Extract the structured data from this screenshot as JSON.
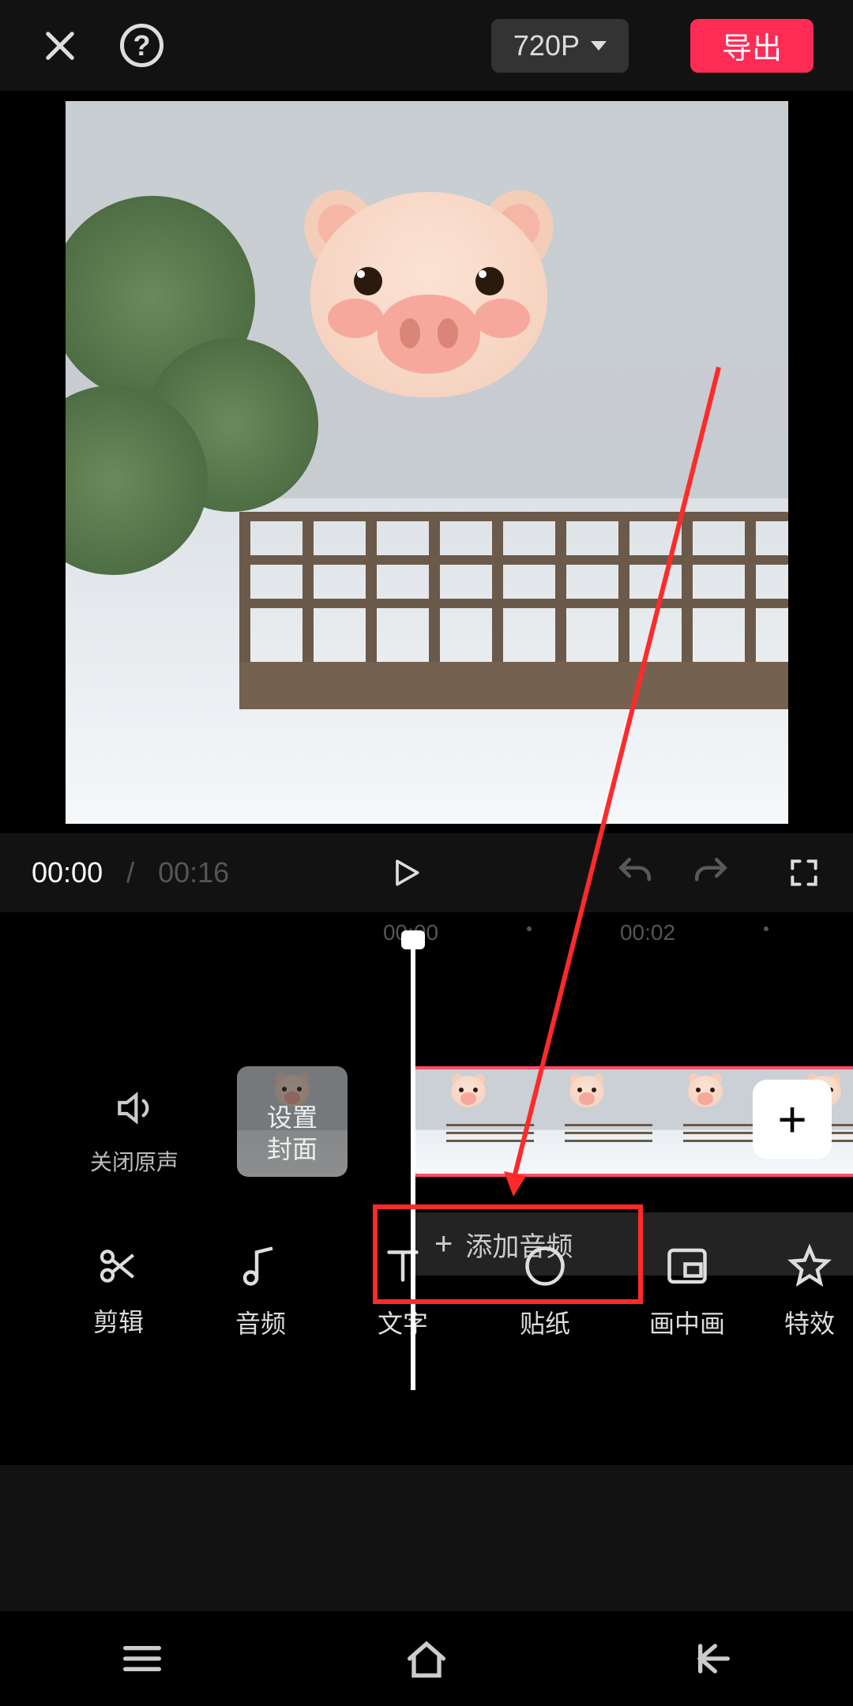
{
  "topbar": {
    "resolution": "720P",
    "export": "导出"
  },
  "playbar": {
    "current": "00:00",
    "total": "00:16"
  },
  "timeline": {
    "ticks": [
      {
        "label": "00:00",
        "pos": 520
      },
      {
        "label": "00:02",
        "pos": 820
      }
    ],
    "mute_label": "关闭原声",
    "cover_label": "设置\n封面",
    "add_audio": "添加音频"
  },
  "tools": [
    {
      "id": "edit",
      "label": "剪辑"
    },
    {
      "id": "audio",
      "label": "音频"
    },
    {
      "id": "text",
      "label": "文字"
    },
    {
      "id": "sticker",
      "label": "贴纸"
    },
    {
      "id": "pip",
      "label": "画中画"
    },
    {
      "id": "effect",
      "label": "特效"
    }
  ]
}
